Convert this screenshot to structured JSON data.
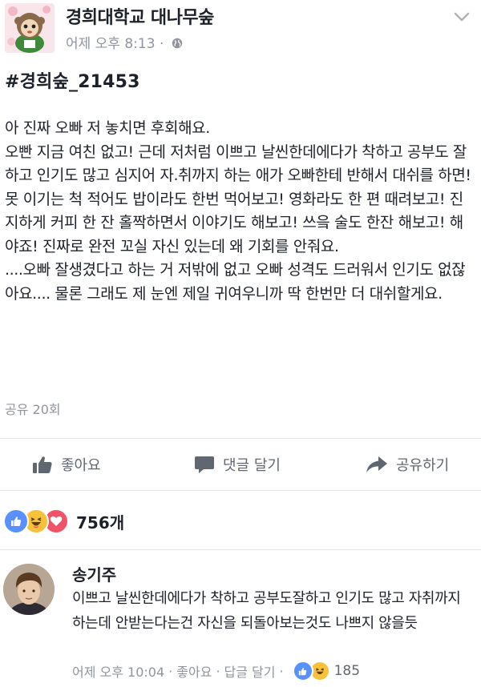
{
  "post": {
    "page_name": "경희대학교 대나무숲",
    "time": "어제 오후 8:13",
    "dot": "·",
    "hashtag": "#경희숲_21453",
    "body": "아 진짜 오빠 저 놓치면 후회해요.\n오빤 지금 여친 없고! 근데 저처럼 이쁘고 날씬한데에다가 착하고 공부도 잘하고 인기도 많고 심지어 자.취까지 하는 애가 오빠한테 반해서 대쉬를 하면!\n못 이기는 척 적어도 밥이라도 한번 먹어보고! 영화라도 한 편 때려보고! 진지하게 커피 한 잔 홀짝하면서 이야기도 해보고! 쓰읔 술도 한잔 해보고! 해야죠! 진짜로 완전 꼬실 자신 있는데 왜 기회를 안줘요.\n....오빠 잘생겼다고 하는 거 저밖에 없고 오빠 성격도 드러워서 인기도 없잖아요.... 물론 그래도 제 눈엔 제일 귀여우니까 딱 한번만 더 대쉬할게요.",
    "share_count": "공유 20회"
  },
  "actions": {
    "like": "좋아요",
    "comment": "댓글 달기",
    "share": "공유하기"
  },
  "reactions": {
    "count": "756개",
    "icons": [
      "like-icon",
      "haha-icon",
      "love-icon"
    ]
  },
  "comment": {
    "author": "송기주",
    "text": "이쁘고 날씬한데에다가 착하고 공부도잘하고 인기도 많고 자취까지하는데 안받는다는건 자신을 되돌아보는것도 나쁘지 않을듯",
    "time": "어제 오후 10:04",
    "dot1": "·",
    "like": "좋아요",
    "dot2": "·",
    "reply": "답글 달기",
    "dot3": "·",
    "reaction_count": "185"
  },
  "colors": {
    "text": "#1d2129",
    "meta": "#90949c",
    "like_blue": "#5890ff",
    "love_red": "#f25268",
    "haha_yellow": "#f7c23a"
  }
}
